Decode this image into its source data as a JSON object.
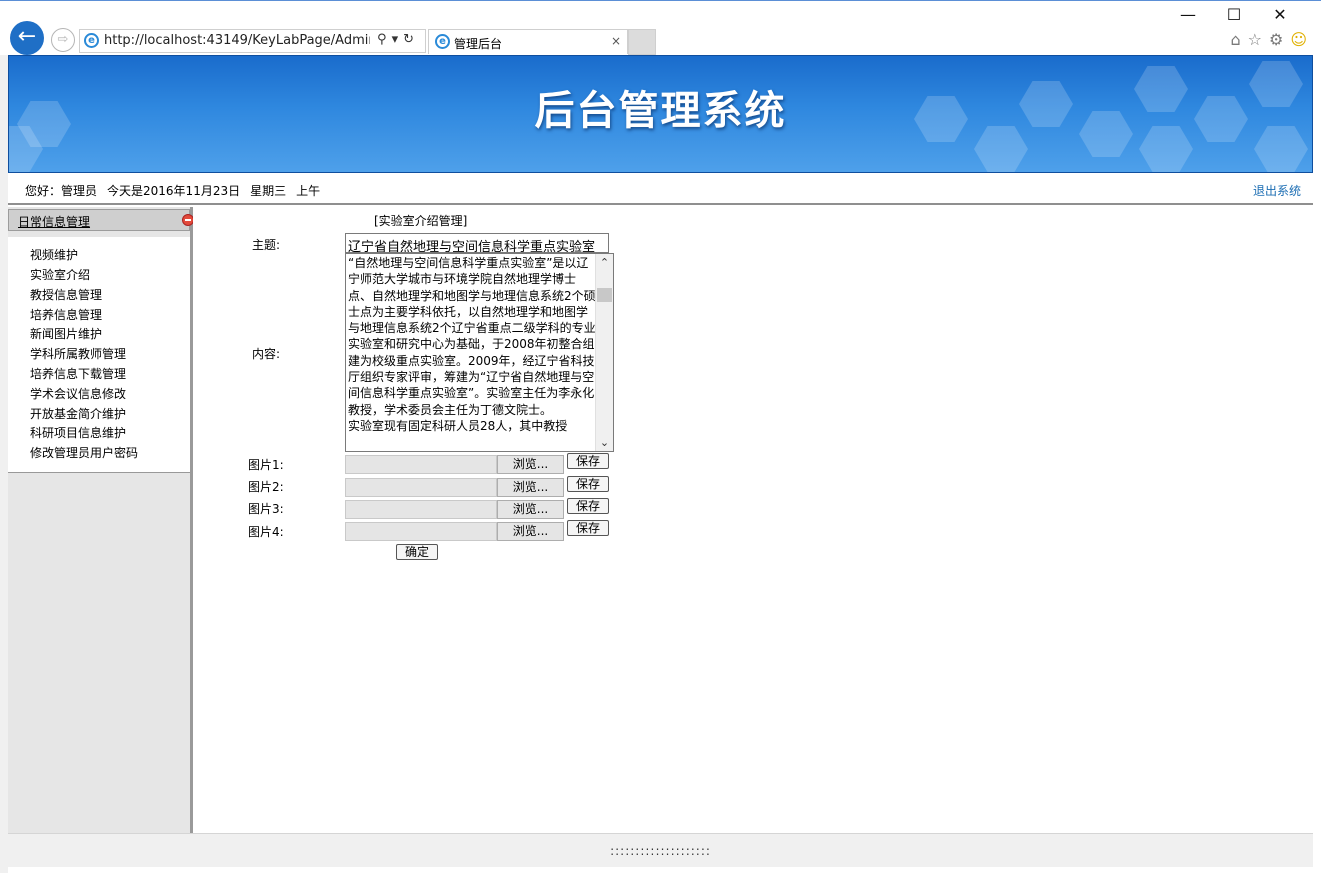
{
  "browser": {
    "url": "http://localhost:43149/KeyLabPage/Admin/ind",
    "tab_title": "管理后台",
    "tab_close": "×",
    "win_minimize": "—",
    "win_maximize": "☐",
    "win_close": "✕"
  },
  "header": {
    "banner_title": "后台管理系统"
  },
  "infobar": {
    "greeting": "您好：管理员",
    "date": "今天是2016年11月23日",
    "weekday": "星期三",
    "period": "上午",
    "logout": "退出系统"
  },
  "sidebar": {
    "section_title": "日常信息管理",
    "items": [
      {
        "label": "视频维护"
      },
      {
        "label": "实验室介绍"
      },
      {
        "label": "教授信息管理"
      },
      {
        "label": "培养信息管理"
      },
      {
        "label": "新闻图片维护"
      },
      {
        "label": "学科所属教师管理"
      },
      {
        "label": "培养信息下载管理"
      },
      {
        "label": "学术会议信息修改"
      },
      {
        "label": "开放基金简介维护"
      },
      {
        "label": "科研项目信息维护"
      },
      {
        "label": "修改管理员用户密码"
      }
    ]
  },
  "form": {
    "heading": "[实验室介绍管理]",
    "subject_label": "主题:",
    "subject_value": "辽宁省自然地理与空间信息科学重点实验室",
    "content_label": "内容:",
    "content_value": "“自然地理与空间信息科学重点实验室”是以辽宁师范大学城市与环境学院自然地理学博士点、自然地理学和地图学与地理信息系统2个硕士点为主要学科依托，以自然地理学和地图学与地理信息系统2个辽宁省重点二级学科的专业实验室和研究中心为基础，于2008年初整合组建为校级重点实验室。2009年，经辽宁省科技厅组织专家评审，筹建为“辽宁省自然地理与空间信息科学重点实验室”。实验室主任为李永化教授，学术委员会主任为丁德文院士。\n实验室现有固定科研人员28人，其中教授",
    "images": [
      {
        "label": "图片1:",
        "browse": "浏览...",
        "save": "保存"
      },
      {
        "label": "图片2:",
        "browse": "浏览...",
        "save": "保存"
      },
      {
        "label": "图片3:",
        "browse": "浏览...",
        "save": "保存"
      },
      {
        "label": "图片4:",
        "browse": "浏览...",
        "save": "保存"
      }
    ],
    "confirm": "确定"
  },
  "footer": {
    "text": "::::::::::::::::::::"
  }
}
